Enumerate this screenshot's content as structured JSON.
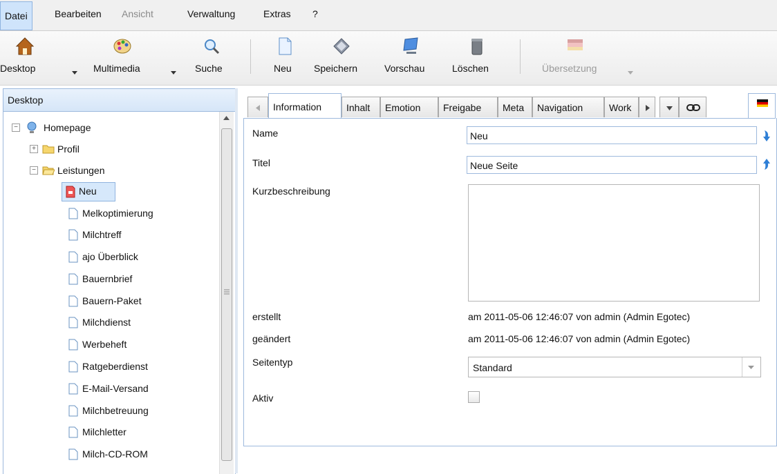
{
  "menubar": {
    "items": [
      {
        "label": "Datei",
        "state": "active"
      },
      {
        "label": "Bearbeiten",
        "state": "normal"
      },
      {
        "label": "Ansicht",
        "state": "disabled"
      },
      {
        "label": "Verwaltung",
        "state": "normal"
      },
      {
        "label": "Extras",
        "state": "normal"
      },
      {
        "label": "?",
        "state": "normal"
      }
    ]
  },
  "toolbar": {
    "desktop": {
      "label": "Desktop",
      "icon": "house-icon"
    },
    "multimedia": {
      "label": "Multimedia",
      "icon": "palette-icon"
    },
    "suche": {
      "label": "Suche",
      "icon": "magnifier-icon"
    },
    "neu": {
      "label": "Neu",
      "icon": "new-page-icon"
    },
    "speichern": {
      "label": "Speichern",
      "icon": "save-disk-icon"
    },
    "vorschau": {
      "label": "Vorschau",
      "icon": "preview-monitor-icon"
    },
    "loeschen": {
      "label": "Löschen",
      "icon": "trash-can-icon"
    },
    "uebersetzung": {
      "label": "Übersetzung",
      "icon": "translation-flag-icon",
      "disabled": true
    }
  },
  "left_panel": {
    "title": "Desktop",
    "tree": {
      "root": {
        "label": "Homepage"
      },
      "profil": {
        "label": "Profil"
      },
      "leistungen": {
        "label": "Leistungen"
      },
      "children": [
        {
          "label": "Neu",
          "selected": true
        },
        {
          "label": "Melkoptimierung"
        },
        {
          "label": "Milchtreff"
        },
        {
          "label": "ajo Überblick"
        },
        {
          "label": "Bauernbrief"
        },
        {
          "label": "Bauern-Paket"
        },
        {
          "label": "Milchdienst"
        },
        {
          "label": "Werbeheft"
        },
        {
          "label": "Ratgeberdienst"
        },
        {
          "label": "E-Mail-Versand"
        },
        {
          "label": "Milchbetreuung"
        },
        {
          "label": "Milchletter"
        },
        {
          "label": "Milch-CD-ROM"
        }
      ]
    }
  },
  "tabs": [
    {
      "label": "Information",
      "active": true
    },
    {
      "label": "Inhalt"
    },
    {
      "label": "Emotion"
    },
    {
      "label": "Freigabe"
    },
    {
      "label": "Meta"
    },
    {
      "label": "Navigation"
    },
    {
      "label": "Work"
    }
  ],
  "form": {
    "name": {
      "label": "Name",
      "value": "Neu"
    },
    "titel": {
      "label": "Titel",
      "value": "Neue Seite"
    },
    "kurzbeschreibung": {
      "label": "Kurzbeschreibung",
      "value": ""
    },
    "erstellt": {
      "label": "erstellt",
      "value": "am 2011-05-06 12:46:07 von admin (Admin Egotec)"
    },
    "geaendert": {
      "label": "geändert",
      "value": "am 2011-05-06 12:46:07 von admin (Admin Egotec)"
    },
    "seitentyp": {
      "label": "Seitentyp",
      "value": "Standard"
    },
    "aktiv": {
      "label": "Aktiv",
      "checked": false
    }
  },
  "colors": {
    "accent_border": "#9db9dd",
    "menu_active_bg": "#cfe4fb",
    "selection_bg": "#d6e8fb",
    "arrow_blue": "#2e7fd6"
  }
}
